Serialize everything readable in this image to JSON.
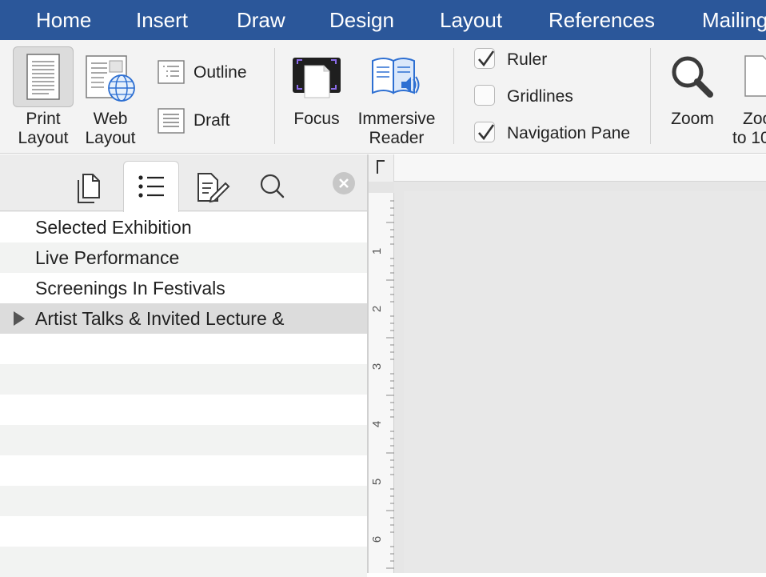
{
  "tabs": [
    "Home",
    "Insert",
    "Draw",
    "Design",
    "Layout",
    "References",
    "Mailing"
  ],
  "ribbon": {
    "views": {
      "print_layout": [
        "Print",
        "Layout"
      ],
      "web_layout": [
        "Web",
        "Layout"
      ],
      "outline": "Outline",
      "draft": "Draft"
    },
    "immersive": {
      "focus": "Focus",
      "immersive_reader": [
        "Immersive",
        "Reader"
      ]
    },
    "show": {
      "ruler": {
        "label": "Ruler",
        "checked": true
      },
      "gridlines": {
        "label": "Gridlines",
        "checked": false
      },
      "navigation_pane": {
        "label": "Navigation Pane",
        "checked": true
      }
    },
    "zoom": {
      "zoom": "Zoom",
      "zoom_100": [
        "Zoo",
        "to 10"
      ]
    }
  },
  "nav_pane": {
    "headings": [
      {
        "text": "Selected Exhibition",
        "expandable": false
      },
      {
        "text": "Live Performance",
        "expandable": false
      },
      {
        "text": "Screenings In Festivals",
        "expandable": false
      },
      {
        "text": "Artist Talks & Invited Lecture &",
        "expandable": true
      }
    ]
  },
  "ruler": {
    "numbers": [
      "1",
      "2",
      "3",
      "4",
      "5",
      "6"
    ]
  },
  "colors": {
    "tabbar": "#2b579a",
    "ribbon": "#f3f3f3",
    "accent_purple": "#7a5bd6",
    "reader_blue": "#2d6fd2"
  }
}
